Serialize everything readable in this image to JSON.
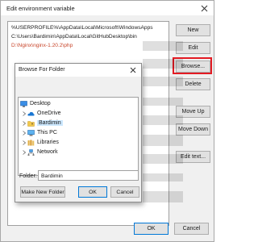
{
  "window": {
    "title": "Edit environment variable"
  },
  "variable_list": [
    {
      "value": "%USERPROFILE%\\AppData\\Local\\Microsoft\\WindowsApps",
      "selected": false
    },
    {
      "value": "C:\\Users\\Bardimin\\AppData\\Local\\GitHubDesktop\\bin",
      "selected": false
    },
    {
      "value": "D:\\Nginx\\nginx-1.20.2\\php",
      "selected": true
    }
  ],
  "buttons": {
    "new": "New",
    "edit": "Edit",
    "browse": "Browse...",
    "delete": "Delete",
    "move_up": "Move Up",
    "move_down": "Move Down",
    "edit_text": "Edit text...",
    "ok": "OK",
    "cancel": "Cancel"
  },
  "browse_dialog": {
    "title": "Browse For Folder",
    "tree": [
      {
        "label": "Desktop",
        "icon": "desktop-icon",
        "level": 0,
        "expandable": false
      },
      {
        "label": "OneDrive",
        "icon": "onedrive-icon",
        "level": 1,
        "expandable": true
      },
      {
        "label": "Bardimin",
        "icon": "user-folder-icon",
        "level": 1,
        "expandable": true,
        "selected": true
      },
      {
        "label": "This PC",
        "icon": "computer-icon",
        "level": 1,
        "expandable": true
      },
      {
        "label": "Libraries",
        "icon": "libraries-icon",
        "level": 1,
        "expandable": true
      },
      {
        "label": "Network",
        "icon": "network-icon",
        "level": 1,
        "expandable": true
      }
    ],
    "folder_label": "Folder:",
    "folder_value": "Bardimin",
    "make_new_folder": "Make New Folder",
    "ok": "OK",
    "cancel": "Cancel"
  },
  "colors": {
    "highlight_box": "#e31b23",
    "selected_path": "#c8452a",
    "tree_selection": "#cce8ff",
    "default_button_border": "#0078d7"
  }
}
